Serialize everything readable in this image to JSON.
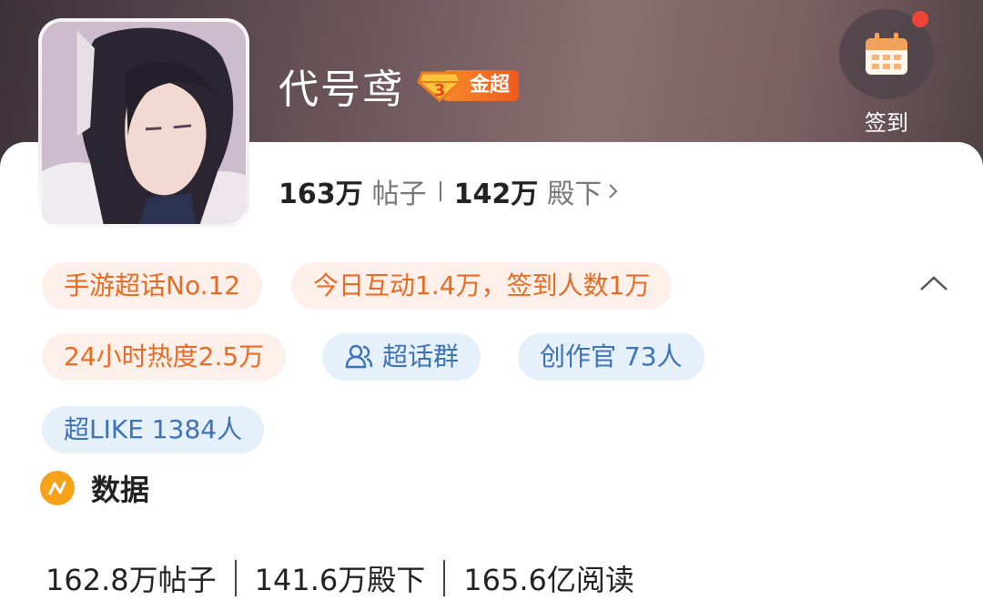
{
  "header": {
    "title": "代号鸢",
    "badge_level": "3",
    "badge_text": "金超",
    "signin_label": "签到"
  },
  "stats": {
    "posts_num": "163万",
    "posts_label": "帖子",
    "followers_num": "142万",
    "followers_label": "殿下"
  },
  "chips": {
    "rank": "手游超话No.12",
    "activity": "今日互动1.4万，签到人数1万",
    "heat": "24小时热度2.5万",
    "group": "超话群",
    "creators": "创作官 73人",
    "superlike": "超LIKE 1384人"
  },
  "data_section": {
    "title": "数据",
    "posts": "162.8万帖子",
    "followers": "141.6万殿下",
    "reads": "165.6亿阅读"
  },
  "colors": {
    "orange_text": "#e96a21",
    "orange_bg": "#fdf0ea",
    "blue_text": "#3c72b8",
    "blue_bg": "#e6f0fb",
    "badge": "#f05a1c",
    "red_dot": "#f0443a",
    "data_icon": "#f5a218"
  },
  "icons": {
    "signin": "calendar-icon",
    "group": "people-icon",
    "collapse": "chevron-up-icon",
    "data": "trend-icon",
    "stats_more": "chevron-right-icon",
    "badge": "diamond-icon"
  }
}
